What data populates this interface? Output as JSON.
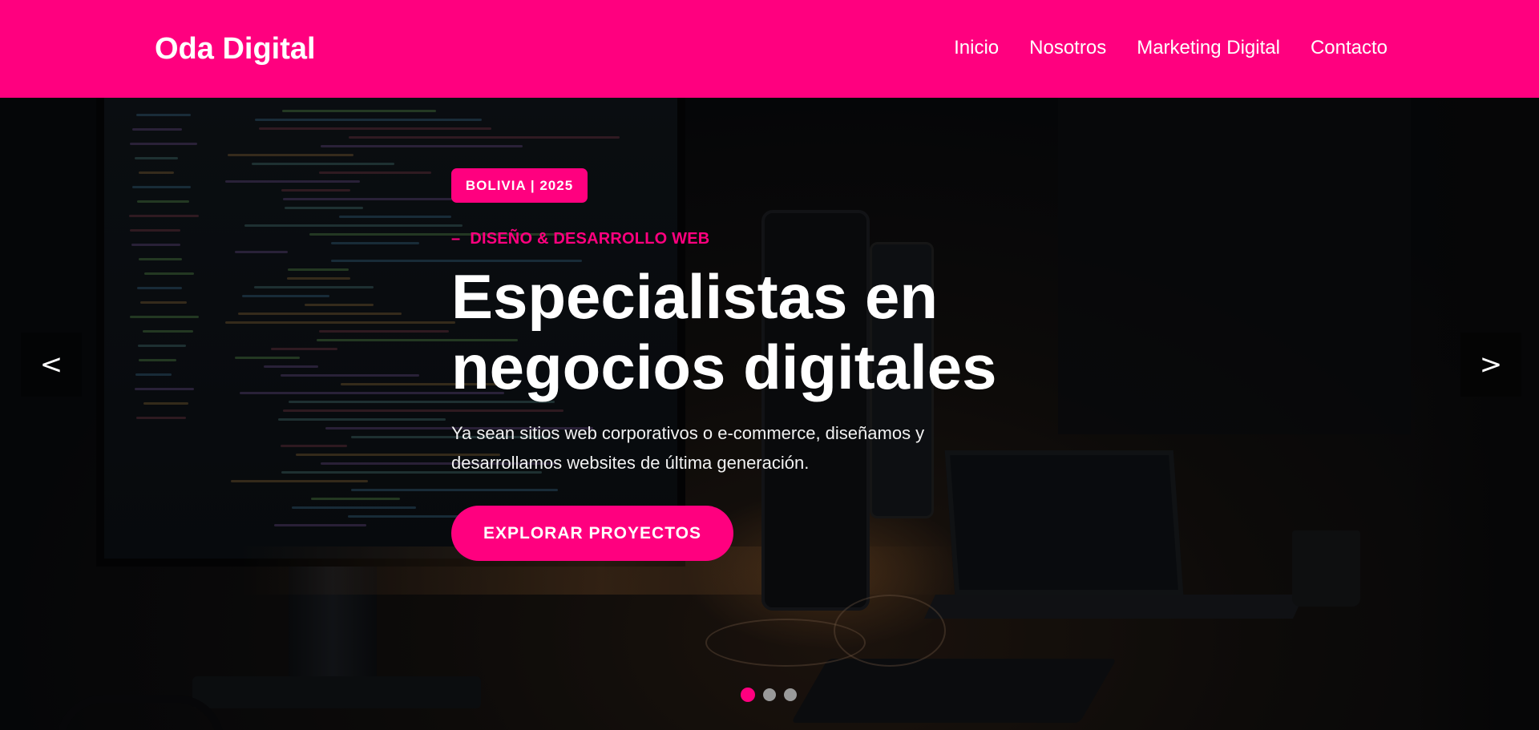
{
  "header": {
    "brand": "Oda Digital",
    "nav": [
      "Inicio",
      "Nosotros",
      "Marketing Digital",
      "Contacto"
    ]
  },
  "hero": {
    "badge": "BOLIVIA | 2025",
    "eyebrow_dash": "–",
    "eyebrow": "DISEÑO & DESARROLLO WEB",
    "headline_line1": "Especialistas en",
    "headline_line2": "negocios digitales",
    "lead_line1": "Ya sean sitios web corporativos o e-commerce, diseñamos y",
    "lead_line2": "desarrollamos websites de última generación.",
    "cta": "EXPLORAR PROYECTOS"
  },
  "carousel": {
    "prev": "<",
    "next": ">",
    "slide_count": 3,
    "active_slide": 1
  },
  "colors": {
    "accent": "#ff007f",
    "dot_inactive": "#9a9a9a",
    "text": "#ffffff"
  }
}
